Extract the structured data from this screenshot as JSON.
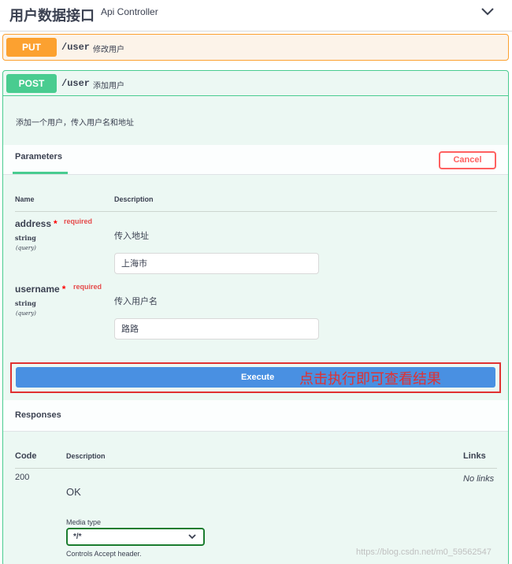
{
  "tag": {
    "title": "用户数据接口",
    "description": "Api Controller"
  },
  "put_op": {
    "method": "PUT",
    "path": "/user",
    "summary": "修改用户"
  },
  "post_op": {
    "method": "POST",
    "path": "/user",
    "summary": "添加用户",
    "description": "添加一个用户，传入用户名和地址",
    "parameters_tab": "Parameters",
    "cancel_label": "Cancel",
    "col_name": "Name",
    "col_description": "Description",
    "params": [
      {
        "name": "address",
        "required_label": "required",
        "type": "string",
        "in": "(query)",
        "description": "传入地址",
        "value": "上海市"
      },
      {
        "name": "username",
        "required_label": "required",
        "type": "string",
        "in": "(query)",
        "description": "传入用户名",
        "value": "路路"
      }
    ],
    "execute_label": "Execute",
    "execute_annotation": "点击执行即可查看结果",
    "responses_title": "Responses",
    "responses_cols": {
      "code": "Code",
      "description": "Description",
      "links": "Links"
    },
    "response": {
      "code": "200",
      "description": "OK",
      "links": "No links",
      "media_type_label": "Media type",
      "media_type_value": "*/*",
      "accept_note": "Controls Accept header."
    }
  },
  "watermark": "https://blog.csdn.net/m0_59562547",
  "colors": {
    "put": "#fca130",
    "post": "#49cc90",
    "execute": "#4990e2",
    "cancel": "#ff6060",
    "annotation": "#e03131"
  }
}
